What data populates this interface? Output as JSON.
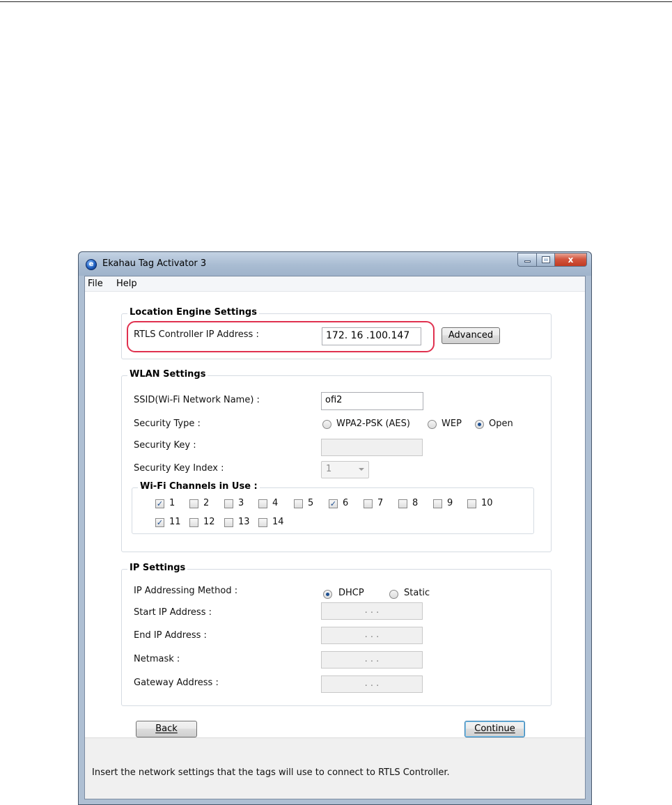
{
  "window": {
    "title": "Ekahau Tag  Activator 3",
    "icon": "ekahau-app-icon",
    "close_glyph": "x"
  },
  "menu": {
    "items": [
      "File",
      "Help"
    ]
  },
  "location_engine": {
    "title": "Location Engine Settings",
    "rtls_label": "RTLS Controller IP Address :",
    "rtls_value": "172. 16 .100.147",
    "advanced_label": "Advanced",
    "highlight_color": "#e0314f"
  },
  "wlan": {
    "title": "WLAN Settings",
    "ssid_label": "SSID(Wi-Fi Network Name) :",
    "ssid_value": "ofi2",
    "security_type_label": "Security Type :",
    "security_options": [
      {
        "label": "WPA2-PSK (AES)",
        "selected": false
      },
      {
        "label": "WEP",
        "selected": false
      },
      {
        "label": "Open",
        "selected": true
      }
    ],
    "security_key_label": "Security Key :",
    "security_key_value": "",
    "key_index_label": "Security Key Index :",
    "key_index_value": "1",
    "channels": {
      "title": "Wi-Fi Channels in Use :",
      "items": [
        {
          "label": "1",
          "checked": true
        },
        {
          "label": "2",
          "checked": false
        },
        {
          "label": "3",
          "checked": false
        },
        {
          "label": "4",
          "checked": false
        },
        {
          "label": "5",
          "checked": false
        },
        {
          "label": "6",
          "checked": true
        },
        {
          "label": "7",
          "checked": false
        },
        {
          "label": "8",
          "checked": false
        },
        {
          "label": "9",
          "checked": false
        },
        {
          "label": "10",
          "checked": false
        },
        {
          "label": "11",
          "checked": true
        },
        {
          "label": "12",
          "checked": false
        },
        {
          "label": "13",
          "checked": false
        },
        {
          "label": "14",
          "checked": false
        }
      ]
    }
  },
  "ip": {
    "title": "IP Settings",
    "method_label": "IP Addressing Method :",
    "method_options": [
      {
        "label": "DHCP",
        "selected": true
      },
      {
        "label": "Static",
        "selected": false
      }
    ],
    "ip_placeholder": ".      .      .",
    "start_label": "Start IP Address :",
    "end_label": "End IP Address :",
    "netmask_label": "Netmask :",
    "gateway_label": "Gateway Address :"
  },
  "buttons": {
    "back": "Back",
    "continue": "Continue"
  },
  "status": {
    "text": "Insert the network settings that the tags will use to connect to RTLS Controller."
  }
}
